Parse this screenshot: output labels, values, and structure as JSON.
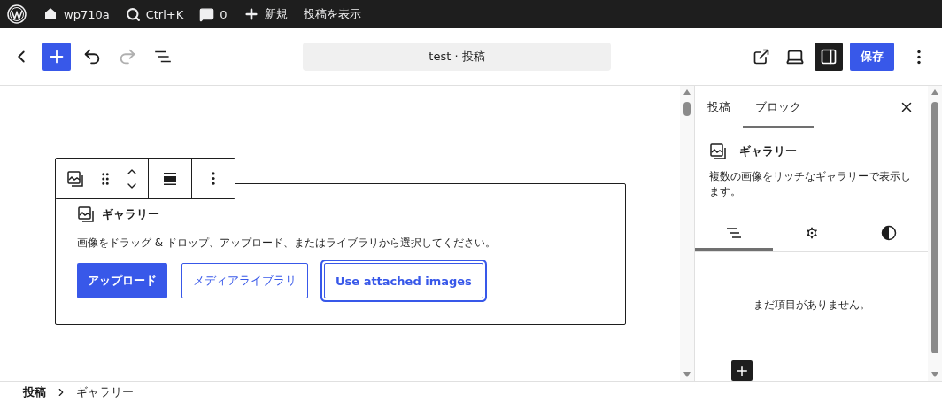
{
  "admin_bar": {
    "site": "wp710a",
    "search": "Ctrl+K",
    "comments": "0",
    "new": "新規",
    "view": "投稿を表示"
  },
  "header": {
    "title": "test · 投稿",
    "save": "保存",
    "undo_disabled": false,
    "redo_disabled": true,
    "sidebar_open": true
  },
  "editor": {
    "block": {
      "name": "ギャラリー",
      "instructions": "画像をドラッグ & ドロップ、アップロード、またはライブラリから選択してください。",
      "buttons": [
        {
          "label": "アップロード",
          "kind": "primary"
        },
        {
          "label": "メディアライブラリ",
          "kind": "secondary"
        },
        {
          "label": "Use attached images",
          "kind": "focused"
        }
      ]
    }
  },
  "sidebar": {
    "tabs": [
      {
        "label": "投稿",
        "selected": false
      },
      {
        "label": "ブロック",
        "selected": true
      }
    ],
    "block_title": "ギャラリー",
    "block_description": "複数の画像をリッチなギャラリーで表示します。",
    "subtabs": [
      {
        "kind": "list",
        "selected": true
      },
      {
        "kind": "settings",
        "selected": false
      },
      {
        "kind": "styles",
        "selected": false
      }
    ],
    "empty_message": "まだ項目がありません。"
  },
  "breadcrumb": [
    "投稿",
    "ギャラリー"
  ]
}
